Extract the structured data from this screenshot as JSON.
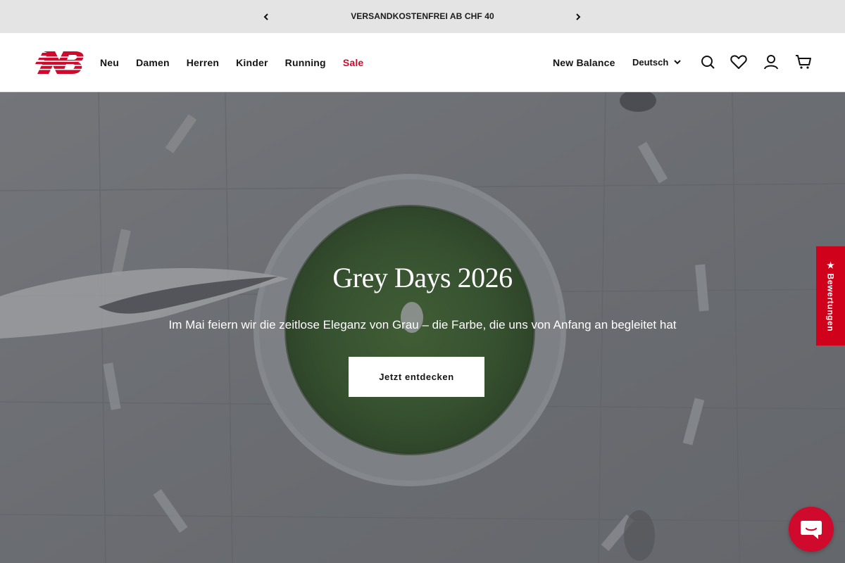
{
  "announcement": {
    "text": "VERSANDKOSTENFREI AB CHF 40",
    "prev_icon": "chevron-left-icon",
    "next_icon": "chevron-right-icon"
  },
  "header": {
    "logo": "new-balance-logo",
    "nav": [
      {
        "label": "Neu"
      },
      {
        "label": "Damen"
      },
      {
        "label": "Herren"
      },
      {
        "label": "Kinder"
      },
      {
        "label": "Running"
      },
      {
        "label": "Sale"
      }
    ],
    "brand_link": "New Balance",
    "language": "Deutsch",
    "icons": [
      "search-icon",
      "heart-icon",
      "user-icon",
      "cart-icon"
    ]
  },
  "hero": {
    "title": "Grey Days 2026",
    "subtitle": "Im Mai feiern wir die zeitlose Eleganz von Grau – die Farbe, die uns von Anfang an begleitet hat",
    "cta": "Jetzt entdecken"
  },
  "reviews_tab": {
    "label": "★ Bewertungen"
  },
  "chat": {
    "icon": "chat-icon"
  },
  "colors": {
    "brand_red": "#cf0a2c",
    "announcement_bg": "#e4e4e4",
    "text_dark": "#151415"
  }
}
